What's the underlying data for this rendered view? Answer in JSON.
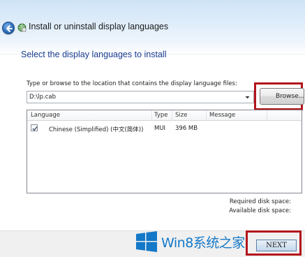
{
  "window": {
    "title": "Install or uninstall display languages"
  },
  "main": {
    "heading": "Select the display languages to install",
    "browse_label": "Type or browse to the location that contains the display language files:",
    "path_value": "D:\\lp.cab",
    "browse_button": "Browse..."
  },
  "list": {
    "columns": [
      "Language",
      "Type",
      "Size",
      "Message"
    ],
    "rows": [
      {
        "checked": true,
        "language": "Chinese (Simplified) (中文(简体))",
        "type": "MUI",
        "size": "396 MB",
        "message": ""
      }
    ]
  },
  "disk": {
    "required_label": "Required disk space:",
    "available_label": "Available disk space:"
  },
  "footer": {
    "watermark": "Win8系统之家",
    "next_button": "NEXT"
  },
  "colors": {
    "heading": "#1a3d8f",
    "highlight": "#b2141b",
    "watermark": "#1478c8"
  },
  "icons": [
    "back-arrow-icon",
    "language-app-icon",
    "dropdown-arrow-icon",
    "checkmark-icon",
    "windows-logo-icon"
  ]
}
